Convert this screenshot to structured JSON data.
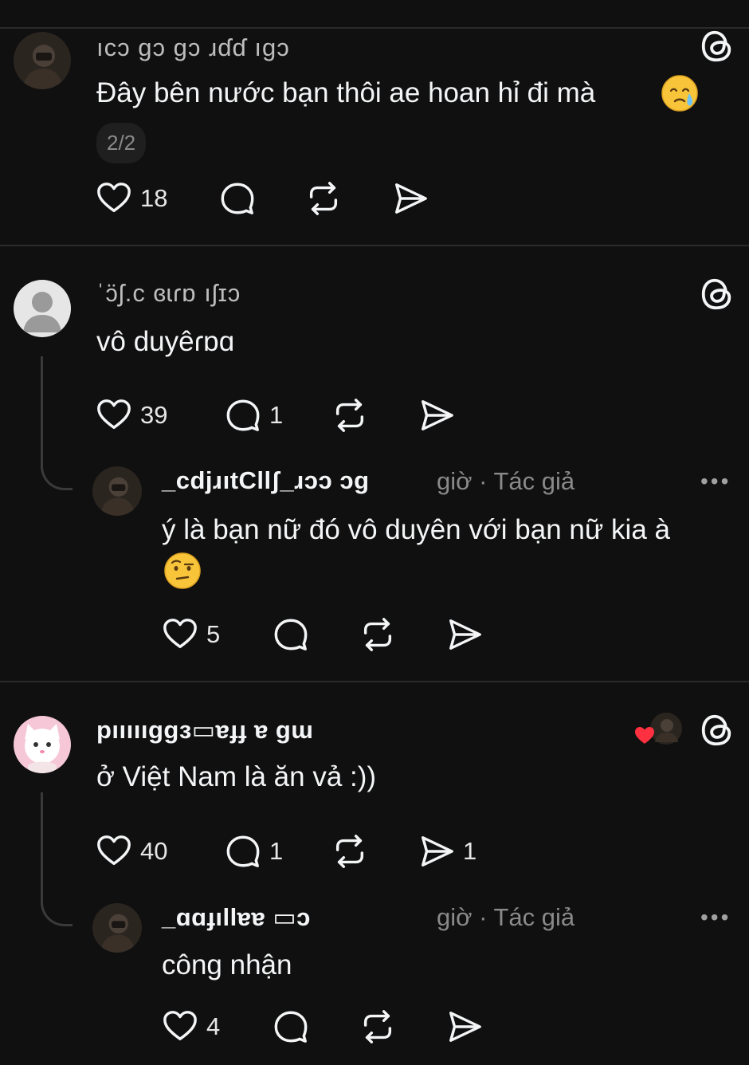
{
  "threads": [
    {
      "username": "ıcɔ ɡɔ ɡɔ ɹɗɗ ıɡɔ",
      "text": "Đây bên nước bạn thôi ae hoan hỉ đi mà",
      "emoji": "😢",
      "page_indicator": "2/2",
      "likes": "18",
      "replies": "",
      "reposts": "",
      "shares": ""
    },
    {
      "username": "ˈɔ̈ʃ.c  ɞɩɾɒ  ıʃɪɔ",
      "text": "vô duyêɾɒɑ",
      "likes": "39",
      "replies": "1",
      "reposts": "",
      "shares": "",
      "reply": {
        "username": "_cdjɹıtCllʃ_ɹɔɔ ɔɡ",
        "meta": "giờ · Tác giả",
        "text_line1": "ý là bạn nữ đó vô duyên với bạn nữ kia à",
        "emoji": "🤨",
        "likes": "5",
        "replies": "",
        "reposts": "",
        "shares": "",
        "more_label": "•••"
      }
    },
    {
      "username": "pıııııggɜ▭ɐɟɟ ɐ ɡɯ",
      "text": "ở Việt Nam là ăn vả :))",
      "likes": "40",
      "replies": "1",
      "reposts": "",
      "shares": "1",
      "liked_by_author_icon": "heart-icon",
      "reply": {
        "username": "_ɑɑɟıllɐɐ ▭ɔ",
        "meta": "giờ · Tác giả",
        "text_line1": "công nhận",
        "likes": "4",
        "replies": "",
        "reposts": "",
        "shares": "",
        "more_label": "•••"
      }
    }
  ],
  "colors": {
    "background": "#101010",
    "text": "#f3f5f7",
    "muted": "#8a8a8a",
    "divider": "#2a2a2a",
    "like_red": "#ff3040"
  }
}
